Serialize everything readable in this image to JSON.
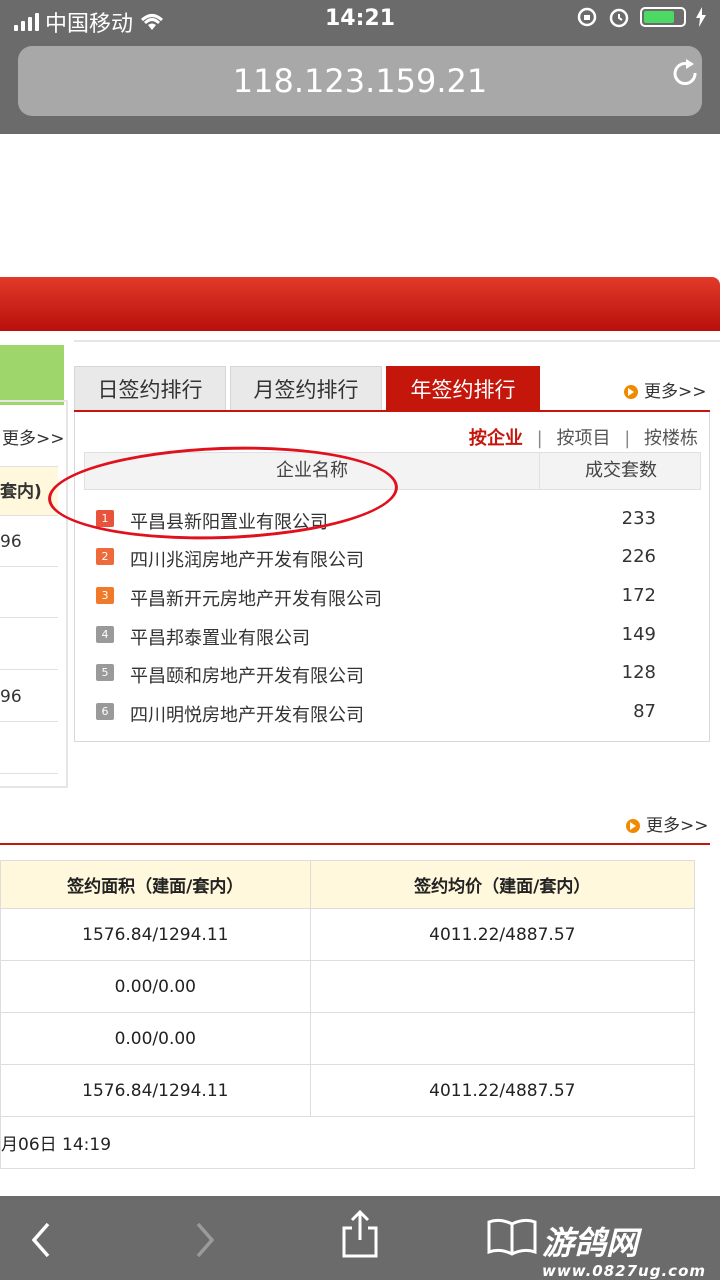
{
  "status_bar": {
    "carrier": "中国移动",
    "time": "14:21"
  },
  "browser": {
    "url": "118.123.159.21"
  },
  "left_panel": {
    "more": "更多>>",
    "header_fragment": "套内)",
    "cells": [
      "96",
      "",
      "",
      "96",
      ""
    ]
  },
  "ranking": {
    "tabs": [
      "日签约排行",
      "月签约排行",
      "年签约排行"
    ],
    "active_tab": "年签约排行",
    "more": "更多>>",
    "filters": [
      "按企业",
      "按项目",
      "按楼栋"
    ],
    "filter_separator": "|",
    "columns": [
      "企业名称",
      "成交套数"
    ],
    "rows": [
      {
        "rank": "1",
        "name": "平昌县新阳置业有限公司",
        "count": "233"
      },
      {
        "rank": "2",
        "name": "四川兆润房地产开发有限公司",
        "count": "226"
      },
      {
        "rank": "3",
        "name": "平昌新开元房地产开发有限公司",
        "count": "172"
      },
      {
        "rank": "4",
        "name": "平昌邦泰置业有限公司",
        "count": "149"
      },
      {
        "rank": "5",
        "name": "平昌颐和房地产开发有限公司",
        "count": "128"
      },
      {
        "rank": "6",
        "name": "四川明悦房地产开发有限公司",
        "count": "87"
      }
    ],
    "rank_colors": [
      "#e8533c",
      "#ef6a3a",
      "#f07a2a",
      "#9a9a9a",
      "#9a9a9a",
      "#9a9a9a"
    ]
  },
  "signing_table": {
    "more": "更多>>",
    "columns": [
      "签约面积（建面/套内）",
      "签约均价（建面/套内）"
    ],
    "rows": [
      [
        "1576.84/1294.11",
        "4011.22/4887.57"
      ],
      [
        "0.00/0.00",
        ""
      ],
      [
        "0.00/0.00",
        ""
      ],
      [
        "1576.84/1294.11",
        "4011.22/4887.57"
      ]
    ],
    "footer": "月06日 14:19"
  },
  "watermark": {
    "text": "游鸽网",
    "url": "www.0827ug.com"
  }
}
